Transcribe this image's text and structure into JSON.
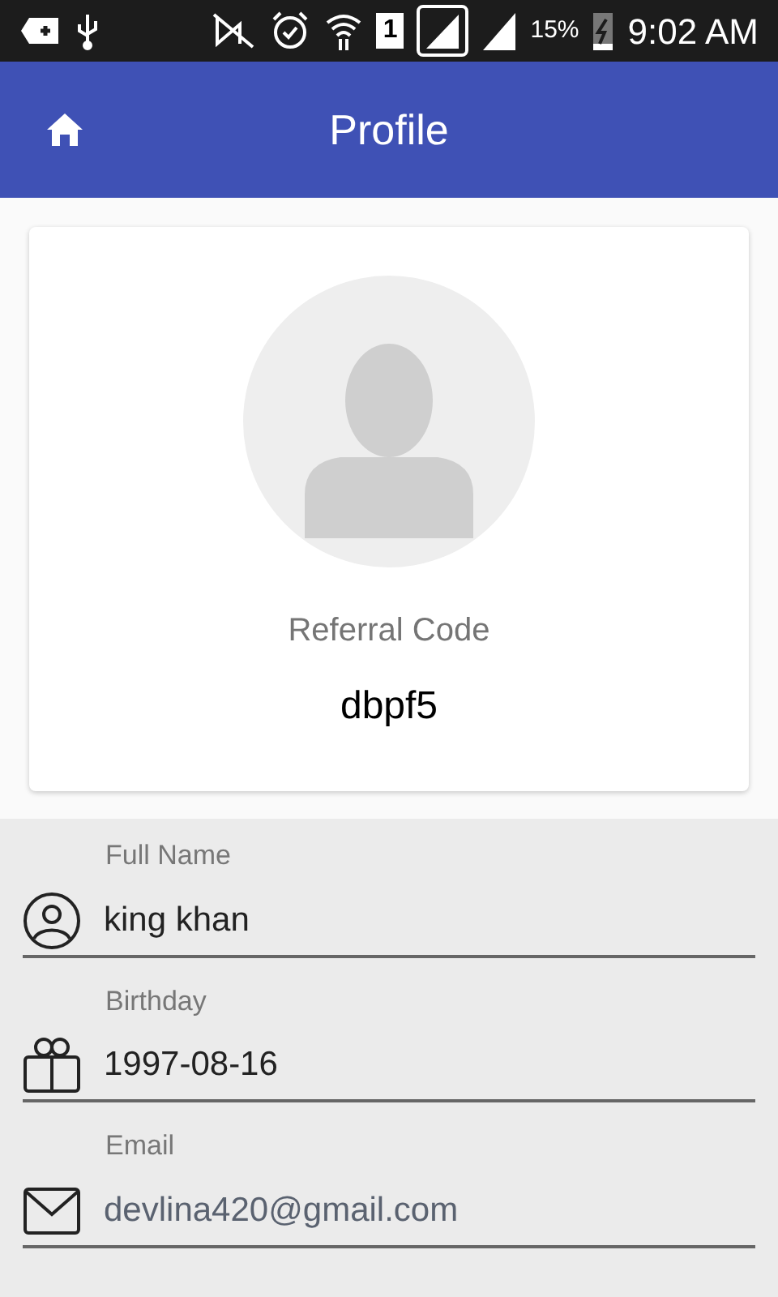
{
  "status_bar": {
    "sim_label": "1",
    "battery": "15%",
    "time": "9:02 AM"
  },
  "header": {
    "title": "Profile"
  },
  "profile": {
    "referral_label": "Referral Code",
    "referral_code": "dbpf5"
  },
  "fields": [
    {
      "kind": "person",
      "label": "Full Name",
      "value": "king khan",
      "disabled": false
    },
    {
      "kind": "gift",
      "label": "Birthday",
      "value": "1997-08-16",
      "disabled": false
    },
    {
      "kind": "mail",
      "label": "Email",
      "value": "devlina420@gmail.com",
      "disabled": true
    }
  ]
}
